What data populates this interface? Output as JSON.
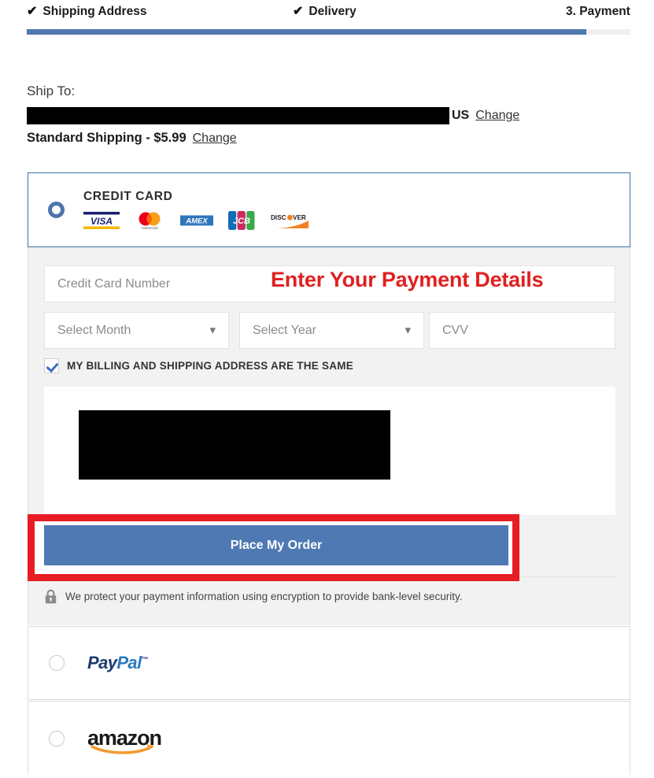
{
  "stepper": {
    "steps": [
      {
        "label": "Shipping Address",
        "state": "complete",
        "icon": "check-icon"
      },
      {
        "label": "Delivery",
        "state": "complete",
        "icon": "check-icon"
      },
      {
        "label": "3. Payment",
        "state": "current",
        "icon": ""
      }
    ],
    "progress_percent": 93,
    "fill_color": "#5077b0",
    "track_color": "#efefef"
  },
  "shipping": {
    "ship_to_label": "Ship To:",
    "address_redacted": "",
    "country": "US",
    "change_address_link": "Change",
    "method": "Standard Shipping - $5.99",
    "change_method_link": "Change"
  },
  "payment": {
    "credit_card": {
      "title": "CREDIT CARD",
      "selected": true,
      "accepted_cards": [
        "VISA",
        "mastercard",
        "AMEX",
        "JCB",
        "DISCOVER"
      ],
      "form": {
        "card_number_placeholder": "Credit Card Number",
        "card_number_value": "",
        "month_placeholder": "Select Month",
        "month_value": "",
        "year_placeholder": "Select Year",
        "year_value": "",
        "cvv_placeholder": "CVV",
        "cvv_value": ""
      },
      "billing_same_label": "MY BILLING AND SHIPPING ADDRESS ARE THE SAME",
      "billing_same_checked": true,
      "billing_address_redacted": "",
      "place_order_label": "Place My Order",
      "security_note": "We protect your payment information using encryption to provide bank-level security.",
      "security_icon": "lock-icon"
    },
    "alternatives": [
      {
        "id": "paypal",
        "logo_text_1": "Pay",
        "logo_text_2": "Pal",
        "trademark": "™",
        "selected": false
      },
      {
        "id": "amazon",
        "logo_text": "amazon",
        "selected": false
      }
    ]
  },
  "annotations": [
    {
      "id": "payment-details-callout",
      "text": "Enter Your Payment Details",
      "color": "#e02020"
    },
    {
      "id": "place-order-highlight",
      "text": "",
      "color": "#e81c23"
    }
  ],
  "colors": {
    "primary_blue": "#4f79b3",
    "panel_border_blue": "#3f6ea8",
    "form_bg": "#f2f2f2",
    "annotation_red": "#e81c23"
  }
}
